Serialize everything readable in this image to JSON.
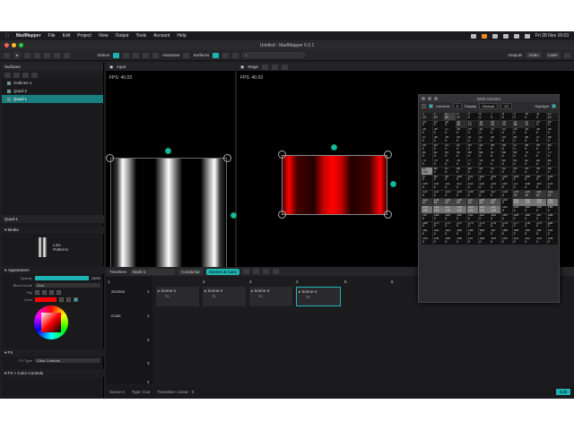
{
  "menubar": {
    "app": "MadMapper",
    "items": [
      "File",
      "Edit",
      "Project",
      "View",
      "Output",
      "Tools",
      "Account",
      "Help"
    ],
    "clock": "Fri 28 Nov 16:03"
  },
  "window": {
    "title": "Untitled - MadMapper 6.0.1"
  },
  "toolbar": {
    "videos": "Videos",
    "autosave": "AutoSave",
    "surfaces": "Surfaces",
    "outputs": "Outputs",
    "video_btn": "Video",
    "laser_btn": "Laser"
  },
  "surfaces_panel": {
    "title": "Surfaces",
    "items": [
      {
        "label": "Outlines-1",
        "selected": false
      },
      {
        "label": "Quad-2",
        "selected": false
      },
      {
        "label": "Quad-1",
        "selected": true
      }
    ]
  },
  "inspector": {
    "title": "Quad-1",
    "media_section": "Media",
    "media_name": "Line Patterns",
    "appearance_section": "Appearance",
    "opacity_label": "Opacity",
    "opacity_value": "100%",
    "blend_label": "Blend mode",
    "blend_value": "Over",
    "flip_label": "Flip",
    "color_label": "Color",
    "color_value": "#ff0000",
    "fx_section": "FX",
    "fx_type_label": "FX Type",
    "fx_type_value": "Color Controls",
    "color_controls_section": "FX > Color Controls"
  },
  "input_pane": {
    "title": "Input",
    "fps": "FPS: 40.03"
  },
  "stage_pane": {
    "title": "Stage",
    "fps": "FPS: 40.03"
  },
  "cues": {
    "timelines": "Timelines",
    "bank": "Bank-1",
    "tab_conductor": "Conductor",
    "tab_scenes": "Scenes & Cues",
    "columns": [
      "1",
      "2",
      "3",
      "4",
      "5",
      "6",
      "7",
      "8"
    ],
    "scenes_row_label": "Scenes",
    "cues_row_label": "Cues",
    "row_numbers": [
      "1",
      "1",
      "2",
      "3",
      "4"
    ],
    "scenes": [
      {
        "name": "Scene-1",
        "dur": "3s"
      },
      {
        "name": "Scene-2",
        "dur": "3s"
      },
      {
        "name": "Scene-3",
        "dur": "3s"
      },
      {
        "name": "Scene-4",
        "dur": "0s"
      }
    ]
  },
  "status": {
    "scene": "Scene-4",
    "type": "Type: Cue",
    "transition": "Transition: Linear - 0",
    "edit": "Edit"
  },
  "dmx": {
    "title": "DMX Monitor",
    "universe_label": "Universe",
    "universe_value": "0",
    "display_label": "Display",
    "display_value": "Manual",
    "display_num": "12",
    "highlight_label": "Highlight",
    "cells": [
      "1",
      "2",
      "3",
      "4",
      "5",
      "6",
      "7",
      "8",
      "9",
      "10",
      "11",
      "12",
      "13",
      "14",
      "15",
      "16",
      "17",
      "18",
      "19",
      "20",
      "21",
      "22",
      "23",
      "24",
      "25",
      "26",
      "27",
      "28",
      "29",
      "30",
      "31",
      "32",
      "33",
      "34",
      "35",
      "36",
      "37",
      "38",
      "39",
      "40",
      "41",
      "42",
      "43",
      "44",
      "45",
      "46",
      "47",
      "48",
      "49",
      "50",
      "51",
      "52",
      "53",
      "54",
      "55",
      "56",
      "57",
      "58",
      "59",
      "60",
      "61",
      "62",
      "63",
      "64",
      "65",
      "66",
      "67",
      "68",
      "69",
      "70",
      "71",
      "72",
      "73",
      "74",
      "75",
      "76",
      "77",
      "78",
      "79",
      "80",
      "81",
      "82",
      "83",
      "84",
      "85",
      "86",
      "87",
      "88",
      "89",
      "90",
      "91",
      "92",
      "93",
      "94",
      "95",
      "96",
      "97",
      "98",
      "99",
      "100",
      "101",
      "102",
      "103",
      "104",
      "105",
      "106",
      "107",
      "108",
      "109",
      "110",
      "111",
      "112",
      "113",
      "114",
      "115",
      "116",
      "117",
      "118",
      "119",
      "120",
      "121",
      "122",
      "123",
      "124",
      "125",
      "126",
      "127",
      "128",
      "129",
      "130",
      "131",
      "132",
      "133",
      "134",
      "135",
      "136",
      "137",
      "138",
      "139",
      "140",
      "141",
      "142",
      "143",
      "144",
      "145",
      "146",
      "147",
      "148",
      "149",
      "150",
      "151",
      "152",
      "153",
      "154",
      "155",
      "156",
      "157",
      "158",
      "159",
      "160",
      "161",
      "162",
      "163",
      "164",
      "165",
      "166",
      "167",
      "168",
      "169",
      "170",
      "171",
      "172",
      "173",
      "174",
      "175",
      "176",
      "177",
      "178",
      "179",
      "180",
      "181",
      "182",
      "183",
      "184",
      "185",
      "186",
      "187",
      "188",
      "189",
      "190",
      "191",
      "192",
      "193",
      "194",
      "195",
      "196",
      "197",
      "198",
      "199",
      "200",
      "201",
      "202",
      "203",
      "204"
    ],
    "values": [
      13,
      20,
      60,
      17,
      0,
      0,
      0,
      0,
      0,
      0,
      0,
      12,
      0,
      0,
      0,
      36,
      13,
      26,
      33,
      23,
      36,
      23,
      0,
      0,
      0,
      0,
      0,
      0,
      0,
      0,
      0,
      0,
      0,
      0,
      0,
      0,
      0,
      0,
      0,
      0,
      0,
      0,
      0,
      0,
      0,
      0,
      0,
      0,
      0,
      0,
      0,
      0,
      0,
      0,
      0,
      0,
      0,
      0,
      0,
      0,
      0,
      0,
      0,
      0,
      0,
      0,
      0,
      0,
      0,
      0,
      0,
      0,
      0,
      0,
      0,
      0,
      0,
      0,
      0,
      0,
      0,
      0,
      0,
      0,
      155,
      0,
      0,
      0,
      0,
      0,
      0,
      0,
      0,
      0,
      0,
      0,
      0,
      0,
      0,
      0,
      0,
      0,
      0,
      0,
      0,
      0,
      0,
      0,
      0,
      0,
      0,
      0,
      0,
      0,
      0,
      0,
      0,
      0,
      0,
      0,
      0,
      0,
      0,
      0,
      0,
      0,
      0,
      0,
      32,
      32,
      47,
      47,
      47,
      62,
      62,
      62,
      62,
      84,
      84,
      0,
      125,
      125,
      125,
      125,
      125,
      125,
      125,
      125,
      125,
      125,
      125,
      0,
      0,
      0,
      0,
      0,
      0,
      0,
      0,
      0,
      0,
      0,
      0,
      0,
      0,
      0,
      0,
      0,
      0,
      0,
      0,
      0,
      0,
      0,
      0,
      0,
      0,
      0,
      0,
      0,
      0,
      0,
      0,
      0,
      0,
      0,
      0,
      0,
      0,
      0,
      0,
      0,
      0,
      0,
      0,
      0,
      0,
      0,
      0,
      0,
      0,
      0,
      0
    ]
  }
}
